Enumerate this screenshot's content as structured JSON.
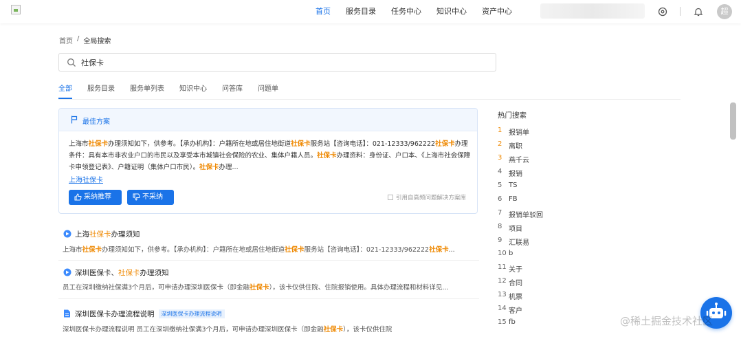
{
  "nav": {
    "items": [
      {
        "label": "首页",
        "active": true
      },
      {
        "label": "服务目录",
        "active": false
      },
      {
        "label": "任务中心",
        "active": false
      },
      {
        "label": "知识中心",
        "active": false
      },
      {
        "label": "资产中心",
        "active": false
      }
    ],
    "avatar_text": "超"
  },
  "breadcrumb": {
    "home": "首页",
    "sep": "/",
    "current": "全局搜索"
  },
  "search": {
    "value": "社保卡"
  },
  "tabs": [
    {
      "label": "全部",
      "active": true
    },
    {
      "label": "服务目录"
    },
    {
      "label": "服务单列表"
    },
    {
      "label": "知识中心"
    },
    {
      "label": "问答库"
    },
    {
      "label": "问题单"
    }
  ],
  "best_answer": {
    "title": "最佳方案",
    "body": [
      {
        "t": "上海市"
      },
      {
        "t": "社保卡",
        "hl": true
      },
      {
        "t": "办理须知如下，供参考。【承办机构】：户籍所在地或居住地街道"
      },
      {
        "t": "社保卡",
        "hl": true
      },
      {
        "t": "服务站【咨询电话】：021-12333/962222"
      },
      {
        "t": "社保卡",
        "hl": true
      },
      {
        "t": "办理条件：具有本市非农业户口的市民以及享受本市城镇社会保险的农业、集体户籍人员。"
      },
      {
        "t": "社保卡",
        "hl": true
      },
      {
        "t": "办理资料：身份证、户口本、《上海市社会保障卡申领登记表》、户籍证明（集体户口市民）。"
      },
      {
        "t": "社保卡",
        "hl": true
      },
      {
        "t": "办理..."
      }
    ],
    "link_prefix": "上海",
    "link_hl": "社保卡",
    "adopt_label": "采纳推荐",
    "reject_label": "不采纳",
    "cite_label": "引用自高频问题解决方案库"
  },
  "results": [
    {
      "title": [
        {
          "t": "上海"
        },
        {
          "t": "社保卡",
          "hl": true
        },
        {
          "t": "办理须知"
        }
      ],
      "icon": "answer-badge-icon",
      "desc": [
        {
          "t": "上海市"
        },
        {
          "t": "社保卡",
          "hl": true
        },
        {
          "t": "办理须知如下，供参考。【承办机构】：户籍所在地或居住地街道"
        },
        {
          "t": "社保卡",
          "hl": true
        },
        {
          "t": "服务站【咨询电话】：021-12333/962222"
        },
        {
          "t": "社保卡",
          "hl": true
        },
        {
          "t": "..."
        }
      ]
    },
    {
      "title": [
        {
          "t": "深圳医保卡、"
        },
        {
          "t": "社保卡",
          "hl": true
        },
        {
          "t": "办理须知"
        }
      ],
      "icon": "answer-badge-icon",
      "desc": [
        {
          "t": "员工在深圳缴纳社保满3个月后，可申请办理深圳医保卡（即金融"
        },
        {
          "t": "社保卡",
          "hl": true
        },
        {
          "t": "），该卡仅供住院、住院报销使用。具体办理流程和材料详见..."
        }
      ]
    },
    {
      "title": [
        {
          "t": "深圳医保卡办理流程说明"
        }
      ],
      "tag": "深圳医保卡办理流程说明",
      "icon": "document-icon",
      "desc": [
        {
          "t": "深圳医保卡办理流程说明 员工在深圳缴纳社保满3个月后，可申请办理深圳医保卡（即金融"
        },
        {
          "t": "社保卡",
          "hl": true
        },
        {
          "t": "），该卡仅供住院"
        }
      ]
    }
  ],
  "hot_search": {
    "title": "热门搜索",
    "items": [
      {
        "n": "1",
        "label": "报销单"
      },
      {
        "n": "2",
        "label": "离职"
      },
      {
        "n": "3",
        "label": "燕千云"
      },
      {
        "n": "4",
        "label": "报销"
      },
      {
        "n": "5",
        "label": "TS"
      },
      {
        "n": "6",
        "label": "FB"
      },
      {
        "n": "7",
        "label": "报销单驳回"
      },
      {
        "n": "8",
        "label": "项目"
      },
      {
        "n": "9",
        "label": "汇联易"
      },
      {
        "n": "10",
        "label": "b"
      },
      {
        "n": "11",
        "label": "关于"
      },
      {
        "n": "12",
        "label": "合同"
      },
      {
        "n": "13",
        "label": "机票"
      },
      {
        "n": "14",
        "label": "客户"
      },
      {
        "n": "15",
        "label": "fb"
      }
    ]
  },
  "watermark": "@稀土掘金技术社区",
  "colors": {
    "primary": "#1a73e8",
    "highlight": "#ef8a05"
  }
}
